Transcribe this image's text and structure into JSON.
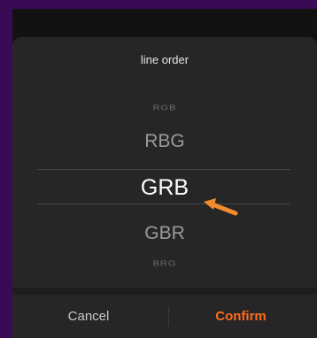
{
  "dialog": {
    "title": "line order",
    "options": [
      "RGB",
      "RBG",
      "GRB",
      "GBR",
      "BRG"
    ],
    "selected": "GRB",
    "cancel_label": "Cancel",
    "confirm_label": "Confirm"
  },
  "colors": {
    "accent": "#ff6a1a",
    "annotation_arrow": "#f28a2e",
    "background": "#3a0a55"
  },
  "icons": {
    "annotation": "arrow-icon"
  }
}
